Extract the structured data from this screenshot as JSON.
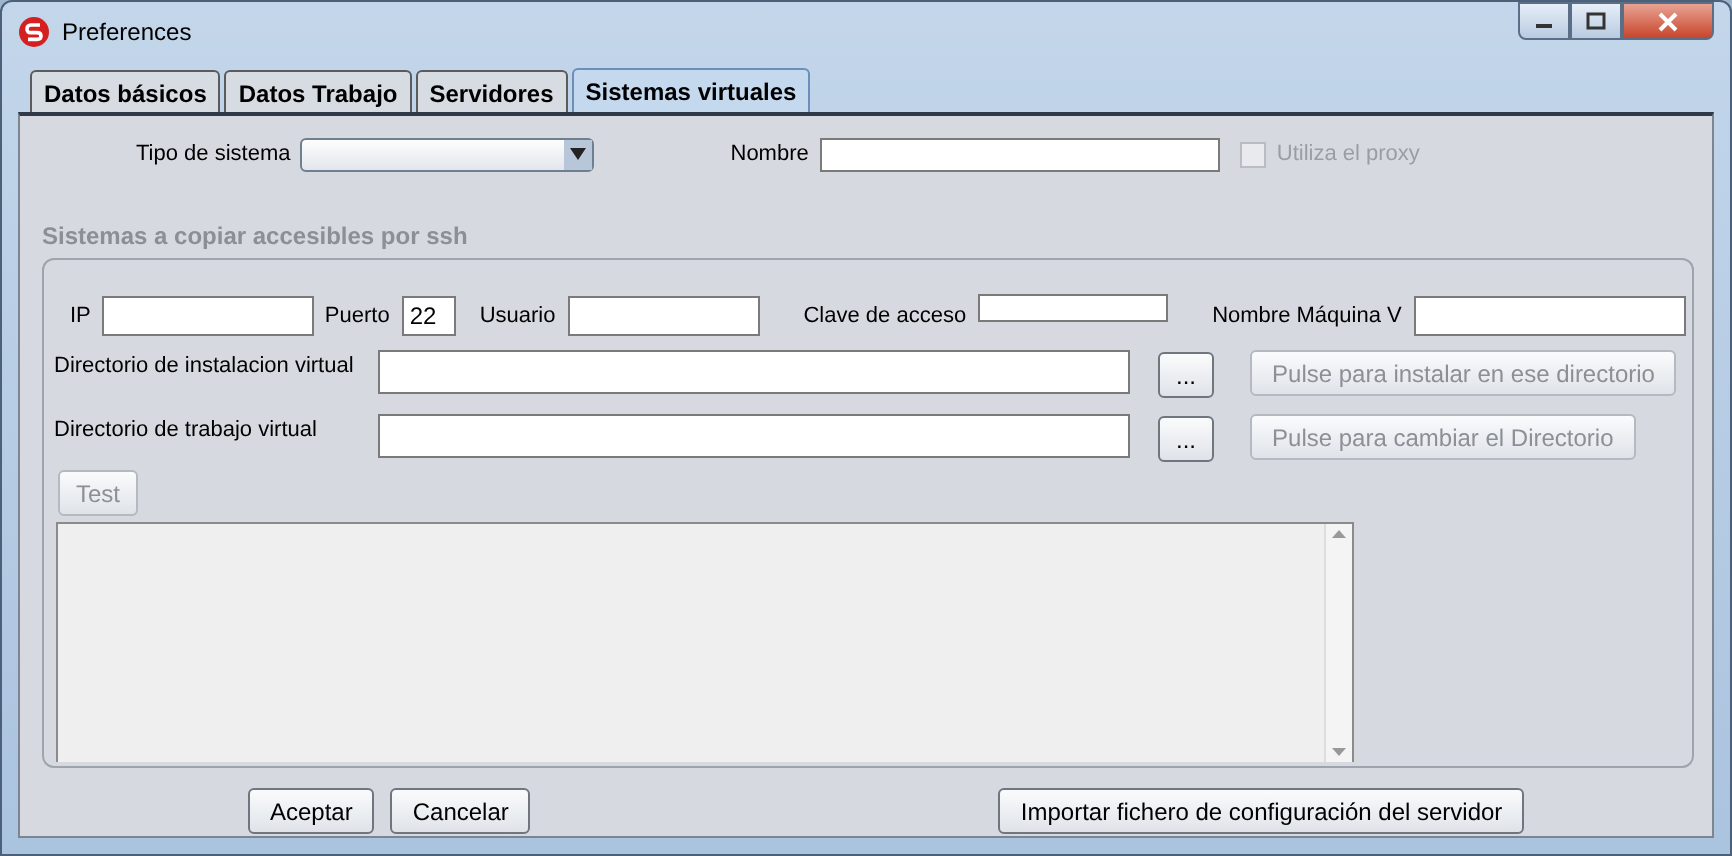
{
  "window": {
    "title": "Preferences"
  },
  "tabs": [
    {
      "label": "Datos básicos",
      "selected": false
    },
    {
      "label": "Datos Trabajo",
      "selected": false
    },
    {
      "label": "Servidores",
      "selected": false
    },
    {
      "label": "Sistemas virtuales",
      "selected": true
    }
  ],
  "system": {
    "type_label": "Tipo de sistema",
    "name_label": "Nombre",
    "proxy": {
      "label": "Utiliza el proxy",
      "checked": false,
      "disabled": true
    }
  },
  "ssh_group": {
    "title": "Sistemas a copiar accesibles por ssh",
    "fields": [
      {
        "label": "IP"
      },
      {
        "label": "Puerto",
        "value": "22"
      },
      {
        "label": "Usuario"
      },
      {
        "label": "Clave de acceso"
      },
      {
        "label": "Nombre Máquina V"
      }
    ],
    "directories": [
      {
        "label": "Directorio de instalacion virtual",
        "browse": "...",
        "action": {
          "label": "Pulse para instalar en ese directorio",
          "disabled": true
        }
      },
      {
        "label": "Directorio de trabajo virtual",
        "browse": "...",
        "action": {
          "label": "Pulse para cambiar el Directorio",
          "disabled": true
        }
      }
    ],
    "test": {
      "label": "Test",
      "disabled": true
    }
  },
  "buttons": [
    {
      "label": "Aceptar"
    },
    {
      "label": "Cancelar"
    }
  ],
  "import_button": {
    "label": "Importar fichero de configuración del servidor"
  }
}
